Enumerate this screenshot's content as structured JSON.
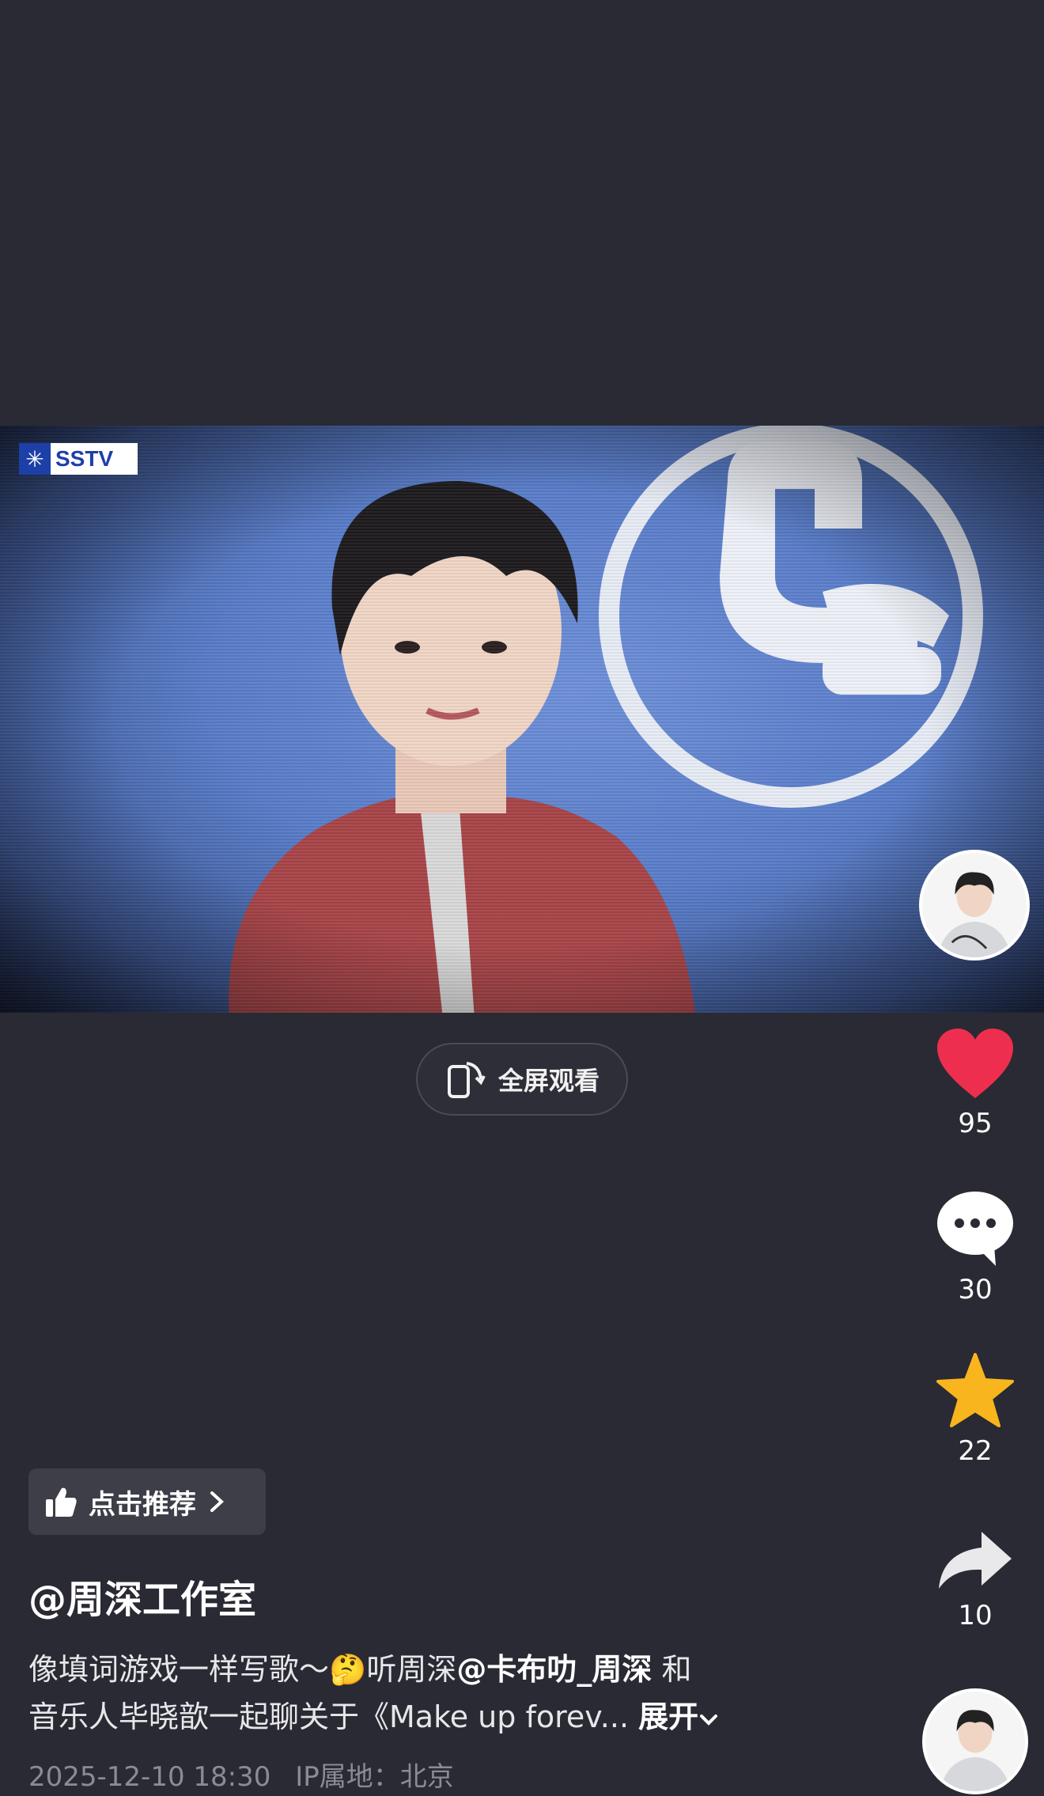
{
  "video": {
    "watermark": "SSTV",
    "fullscreen_label": "全屏观看"
  },
  "actions": {
    "likes": "95",
    "comments": "30",
    "favorites": "22",
    "shares": "10"
  },
  "post": {
    "recommend_label": "点击推荐",
    "author": "@周深工作室",
    "desc_line1_part1": "像填词游戏一样写歌～",
    "emoji": "🤔",
    "desc_line1_part2": "听周深",
    "mention": "@卡布叻_周深",
    "desc_line1_part3": " 和",
    "desc_line2": "音乐人毕晓歆一起聊关于《Make up forev...",
    "expand_label": "展开",
    "date": "2025-12-10 18:30",
    "ip": "IP属地：北京"
  },
  "colors": {
    "background": "#292a33",
    "like": "#ee2e4f",
    "favorite": "#f8b51d",
    "muted": "#8a8b93"
  }
}
